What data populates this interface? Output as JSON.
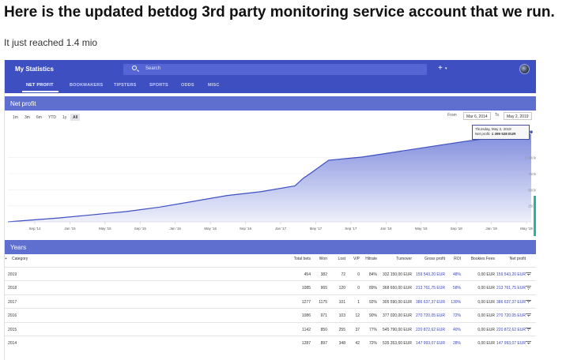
{
  "post": {
    "title": "Here is the updated betdog 3rd party monitoring service account that we run.",
    "subtitle": "It just reached 1.4 mio"
  },
  "app": {
    "title": "My Statistics",
    "search_placeholder": "Search",
    "plus": "+",
    "plus_caret": "▾",
    "accent": "#3d4fc1"
  },
  "nav": {
    "items": [
      "NET PROFIT",
      "BOOKMAKERS",
      "TIPSTERS",
      "SPORTS",
      "ODDS",
      "MISC"
    ],
    "active": "NET PROFIT"
  },
  "net_profit": {
    "header": "Net profit",
    "ranges": [
      "1m",
      "3m",
      "6m",
      "YTD",
      "1y",
      "All"
    ],
    "active_range": "All",
    "from_label": "From",
    "from_date": "Mar 6, 2014",
    "to_label": "To",
    "to_date": "May 2, 2019",
    "tooltip_date": "Thursday, May 2, 2019",
    "tooltip_label": "Net profit:",
    "tooltip_value": "1 399 528 EUR"
  },
  "chart_data": {
    "type": "area",
    "title": "",
    "xlabel": "",
    "ylabel": "",
    "x_ticks": [
      "Sep '14",
      "Jan '15",
      "May '15",
      "Sep '15",
      "Jan '16",
      "May '16",
      "Sep '16",
      "Jan '17",
      "May '17",
      "Sep '17",
      "Jan '18",
      "May '18",
      "Sep '18",
      "Jan '19",
      "May '19"
    ],
    "y_ticks": [
      "1 000k",
      "750k",
      "500k",
      "250k"
    ],
    "ylim": [
      0,
      1500000
    ],
    "x": [
      "Mar '14",
      "Sep '14",
      "Jan '15",
      "May '15",
      "Sep '15",
      "Jan '16",
      "May '16",
      "Sep '16",
      "Jan '17",
      "Feb '17",
      "Mar '17",
      "May '17",
      "Sep '17",
      "Jan '18",
      "May '18",
      "Sep '18",
      "Jan '19",
      "May '19"
    ],
    "values": [
      0,
      60000,
      110000,
      160000,
      230000,
      320000,
      410000,
      470000,
      560000,
      680000,
      770000,
      960000,
      1010000,
      1090000,
      1170000,
      1250000,
      1320000,
      1399528
    ],
    "series": [
      {
        "name": "Net profit"
      }
    ],
    "grid": true,
    "colors": {
      "line": "#3d4fc1",
      "fill_top": "#7e8bdc",
      "fill_bottom": "#eef0fb"
    }
  },
  "years": {
    "header": "Years",
    "columns": [
      "Category",
      "Total bets",
      "Won",
      "Lost",
      "V/P",
      "Hitrate",
      "Turnover",
      "Gross profit",
      "ROI",
      "Bookies Fees",
      "Net profit"
    ],
    "rows": [
      {
        "category": "2019",
        "total_bets": "454",
        "won": "382",
        "lost": "72",
        "vp": "0",
        "hitrate": "84%",
        "turnover": "332 150,00 EUR",
        "gross_profit": "159 543,20 EUR",
        "roi": "48%",
        "fees": "0,00 EUR",
        "net_profit": "159 543,20 EUR"
      },
      {
        "category": "2018",
        "total_bets": "1085",
        "won": "965",
        "lost": "120",
        "vp": "0",
        "hitrate": "89%",
        "turnover": "368 650,00 EUR",
        "gross_profit": "213 761,75 EUR",
        "roi": "58%",
        "fees": "0,00 EUR",
        "net_profit": "213 761,75 EUR"
      },
      {
        "category": "2017",
        "total_bets": "1277",
        "won": "1175",
        "lost": "101",
        "vp": "1",
        "hitrate": "92%",
        "turnover": "305 590,00 EUR",
        "gross_profit": "386 637,37 EUR",
        "roi": "130%",
        "fees": "0,00 EUR",
        "net_profit": "386 637,37 EUR"
      },
      {
        "category": "2016",
        "total_bets": "1086",
        "won": "971",
        "lost": "103",
        "vp": "12",
        "hitrate": "90%",
        "turnover": "377 020,00 EUR",
        "gross_profit": "270 720,05 EUR",
        "roi": "72%",
        "fees": "0,00 EUR",
        "net_profit": "270 720,05 EUR"
      },
      {
        "category": "2015",
        "total_bets": "1142",
        "won": "850",
        "lost": "255",
        "vp": "37",
        "hitrate": "77%",
        "turnover": "545 790,00 EUR",
        "gross_profit": "220 872,62 EUR",
        "roi": "40%",
        "fees": "0,00 EUR",
        "net_profit": "220 872,62 EUR"
      },
      {
        "category": "2014",
        "total_bets": "1287",
        "won": "897",
        "lost": "348",
        "vp": "42",
        "hitrate": "72%",
        "turnover": "535 353,60 EUR",
        "gross_profit": "147 993,07 EUR",
        "roi": "28%",
        "fees": "0,00 EUR",
        "net_profit": "147 993,07 EUR"
      }
    ]
  }
}
